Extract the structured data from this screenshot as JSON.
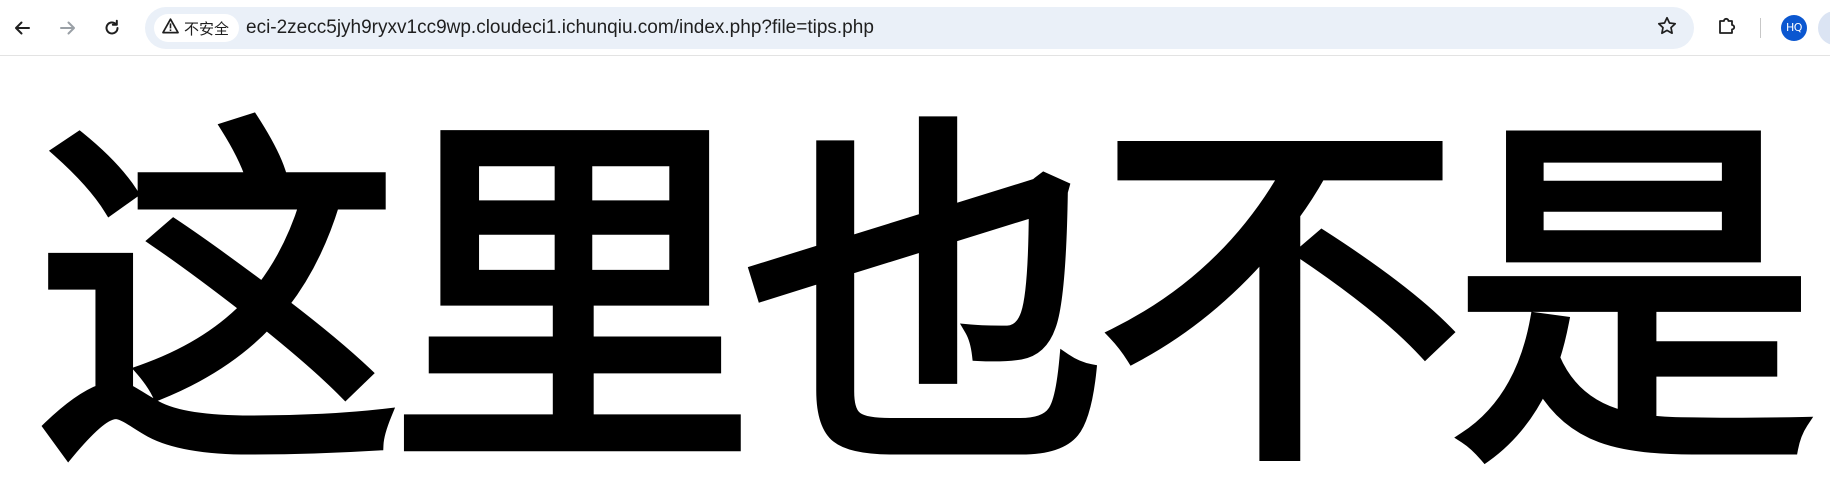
{
  "browser": {
    "security_label": "不安全",
    "url": "eci-2zecc5jyh9ryxv1cc9wp.cloudeci1.ichunqiu.com/index.php?file=tips.php",
    "profile_initials": "HQ",
    "icons": {
      "back": "back-arrow-icon",
      "forward": "forward-arrow-icon",
      "reload": "reload-icon",
      "warning": "warning-triangle-icon",
      "bookmark": "star-icon",
      "extensions": "puzzle-icon"
    },
    "colors": {
      "omnibox_bg": "#eaf0f8",
      "avatar_bg": "#0b57d0"
    }
  },
  "page": {
    "heading": "这里也不是"
  }
}
